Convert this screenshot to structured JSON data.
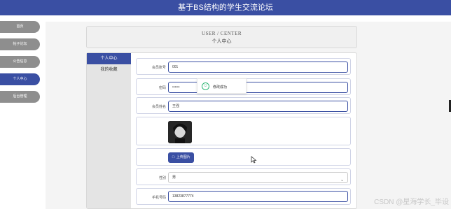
{
  "header": {
    "title": "基于BS结构的学生交流论坛"
  },
  "nav": {
    "items": [
      {
        "label": "首页"
      },
      {
        "label": "帖子论坛"
      },
      {
        "label": "公告信息"
      },
      {
        "label": "个人中心",
        "active": true
      },
      {
        "label": "后台管理"
      }
    ]
  },
  "center_card": {
    "title_en": "USER / CENTER",
    "title_zh": "个人中心"
  },
  "submenu": {
    "items": [
      {
        "label": "个人中心",
        "active": true
      },
      {
        "label": "我的收藏"
      }
    ]
  },
  "form": {
    "account": {
      "label": "会员账号",
      "value": "001"
    },
    "password": {
      "label": "密码",
      "value": "••••••"
    },
    "name": {
      "label": "会员姓名",
      "value": "王强"
    },
    "upload_label": "上传图片",
    "gender": {
      "label": "性别",
      "value": "男"
    },
    "phone": {
      "label": "手机号码",
      "value": "13823877774"
    }
  },
  "toast": {
    "message": "修改成功"
  },
  "watermark": "CSDN @星海学长_毕设",
  "colors": {
    "primary": "#3a4fa3",
    "nav_inactive": "#8e8e8e",
    "success": "#2bb673"
  }
}
